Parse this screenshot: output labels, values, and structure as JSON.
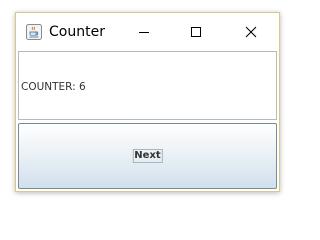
{
  "window": {
    "title": "Counter",
    "app_icon": "java-app-icon",
    "controls": {
      "minimize_icon": "minimize-icon",
      "maximize_icon": "maximize-icon",
      "close_icon": "close-icon"
    },
    "border_color": "#d6c98a"
  },
  "content": {
    "counter_text": "COUNTER: 6"
  },
  "button": {
    "label": "Next"
  }
}
